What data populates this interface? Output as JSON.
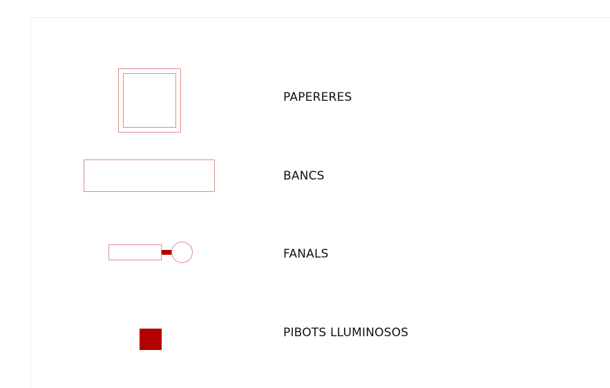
{
  "legend": {
    "items": [
      {
        "label": "PAPERERES",
        "icon": "double-square-icon"
      },
      {
        "label": "BANCS",
        "icon": "rectangle-icon"
      },
      {
        "label": "FANALS",
        "icon": "streetlight-icon"
      },
      {
        "label": "PIBOTS LLUMINOSOS",
        "icon": "filled-square-icon"
      }
    ]
  },
  "colors": {
    "outline": "#e08a8a",
    "fill": "#b30000",
    "text": "#111111"
  }
}
